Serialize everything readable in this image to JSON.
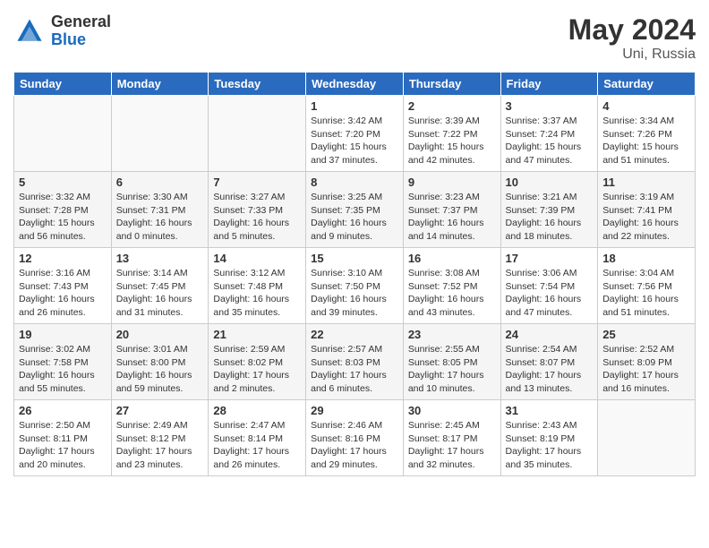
{
  "header": {
    "logo_general": "General",
    "logo_blue": "Blue",
    "month_year": "May 2024",
    "location": "Uni, Russia"
  },
  "weekdays": [
    "Sunday",
    "Monday",
    "Tuesday",
    "Wednesday",
    "Thursday",
    "Friday",
    "Saturday"
  ],
  "weeks": [
    [
      {
        "day": "",
        "info": ""
      },
      {
        "day": "",
        "info": ""
      },
      {
        "day": "",
        "info": ""
      },
      {
        "day": "1",
        "info": "Sunrise: 3:42 AM\nSunset: 7:20 PM\nDaylight: 15 hours\nand 37 minutes."
      },
      {
        "day": "2",
        "info": "Sunrise: 3:39 AM\nSunset: 7:22 PM\nDaylight: 15 hours\nand 42 minutes."
      },
      {
        "day": "3",
        "info": "Sunrise: 3:37 AM\nSunset: 7:24 PM\nDaylight: 15 hours\nand 47 minutes."
      },
      {
        "day": "4",
        "info": "Sunrise: 3:34 AM\nSunset: 7:26 PM\nDaylight: 15 hours\nand 51 minutes."
      }
    ],
    [
      {
        "day": "5",
        "info": "Sunrise: 3:32 AM\nSunset: 7:28 PM\nDaylight: 15 hours\nand 56 minutes."
      },
      {
        "day": "6",
        "info": "Sunrise: 3:30 AM\nSunset: 7:31 PM\nDaylight: 16 hours\nand 0 minutes."
      },
      {
        "day": "7",
        "info": "Sunrise: 3:27 AM\nSunset: 7:33 PM\nDaylight: 16 hours\nand 5 minutes."
      },
      {
        "day": "8",
        "info": "Sunrise: 3:25 AM\nSunset: 7:35 PM\nDaylight: 16 hours\nand 9 minutes."
      },
      {
        "day": "9",
        "info": "Sunrise: 3:23 AM\nSunset: 7:37 PM\nDaylight: 16 hours\nand 14 minutes."
      },
      {
        "day": "10",
        "info": "Sunrise: 3:21 AM\nSunset: 7:39 PM\nDaylight: 16 hours\nand 18 minutes."
      },
      {
        "day": "11",
        "info": "Sunrise: 3:19 AM\nSunset: 7:41 PM\nDaylight: 16 hours\nand 22 minutes."
      }
    ],
    [
      {
        "day": "12",
        "info": "Sunrise: 3:16 AM\nSunset: 7:43 PM\nDaylight: 16 hours\nand 26 minutes."
      },
      {
        "day": "13",
        "info": "Sunrise: 3:14 AM\nSunset: 7:45 PM\nDaylight: 16 hours\nand 31 minutes."
      },
      {
        "day": "14",
        "info": "Sunrise: 3:12 AM\nSunset: 7:48 PM\nDaylight: 16 hours\nand 35 minutes."
      },
      {
        "day": "15",
        "info": "Sunrise: 3:10 AM\nSunset: 7:50 PM\nDaylight: 16 hours\nand 39 minutes."
      },
      {
        "day": "16",
        "info": "Sunrise: 3:08 AM\nSunset: 7:52 PM\nDaylight: 16 hours\nand 43 minutes."
      },
      {
        "day": "17",
        "info": "Sunrise: 3:06 AM\nSunset: 7:54 PM\nDaylight: 16 hours\nand 47 minutes."
      },
      {
        "day": "18",
        "info": "Sunrise: 3:04 AM\nSunset: 7:56 PM\nDaylight: 16 hours\nand 51 minutes."
      }
    ],
    [
      {
        "day": "19",
        "info": "Sunrise: 3:02 AM\nSunset: 7:58 PM\nDaylight: 16 hours\nand 55 minutes."
      },
      {
        "day": "20",
        "info": "Sunrise: 3:01 AM\nSunset: 8:00 PM\nDaylight: 16 hours\nand 59 minutes."
      },
      {
        "day": "21",
        "info": "Sunrise: 2:59 AM\nSunset: 8:02 PM\nDaylight: 17 hours\nand 2 minutes."
      },
      {
        "day": "22",
        "info": "Sunrise: 2:57 AM\nSunset: 8:03 PM\nDaylight: 17 hours\nand 6 minutes."
      },
      {
        "day": "23",
        "info": "Sunrise: 2:55 AM\nSunset: 8:05 PM\nDaylight: 17 hours\nand 10 minutes."
      },
      {
        "day": "24",
        "info": "Sunrise: 2:54 AM\nSunset: 8:07 PM\nDaylight: 17 hours\nand 13 minutes."
      },
      {
        "day": "25",
        "info": "Sunrise: 2:52 AM\nSunset: 8:09 PM\nDaylight: 17 hours\nand 16 minutes."
      }
    ],
    [
      {
        "day": "26",
        "info": "Sunrise: 2:50 AM\nSunset: 8:11 PM\nDaylight: 17 hours\nand 20 minutes."
      },
      {
        "day": "27",
        "info": "Sunrise: 2:49 AM\nSunset: 8:12 PM\nDaylight: 17 hours\nand 23 minutes."
      },
      {
        "day": "28",
        "info": "Sunrise: 2:47 AM\nSunset: 8:14 PM\nDaylight: 17 hours\nand 26 minutes."
      },
      {
        "day": "29",
        "info": "Sunrise: 2:46 AM\nSunset: 8:16 PM\nDaylight: 17 hours\nand 29 minutes."
      },
      {
        "day": "30",
        "info": "Sunrise: 2:45 AM\nSunset: 8:17 PM\nDaylight: 17 hours\nand 32 minutes."
      },
      {
        "day": "31",
        "info": "Sunrise: 2:43 AM\nSunset: 8:19 PM\nDaylight: 17 hours\nand 35 minutes."
      },
      {
        "day": "",
        "info": ""
      }
    ]
  ]
}
